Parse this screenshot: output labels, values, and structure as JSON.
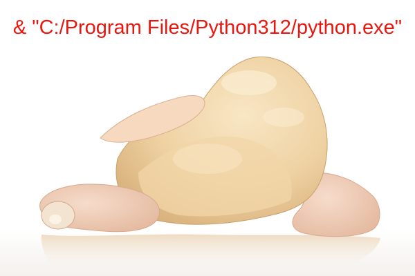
{
  "caption": {
    "text": "& \"C:/Program Files/Python312/python.exe\"",
    "color": "#e8170f"
  },
  "photo": {
    "subject": "raw whole chicken on white reflective surface",
    "colors": {
      "background": "#ffffff",
      "skin_light": "#f3ddb3",
      "skin_mid": "#e8c592",
      "skin_shadow": "#c9a06b",
      "leg_pink": "#efc7b0"
    }
  }
}
